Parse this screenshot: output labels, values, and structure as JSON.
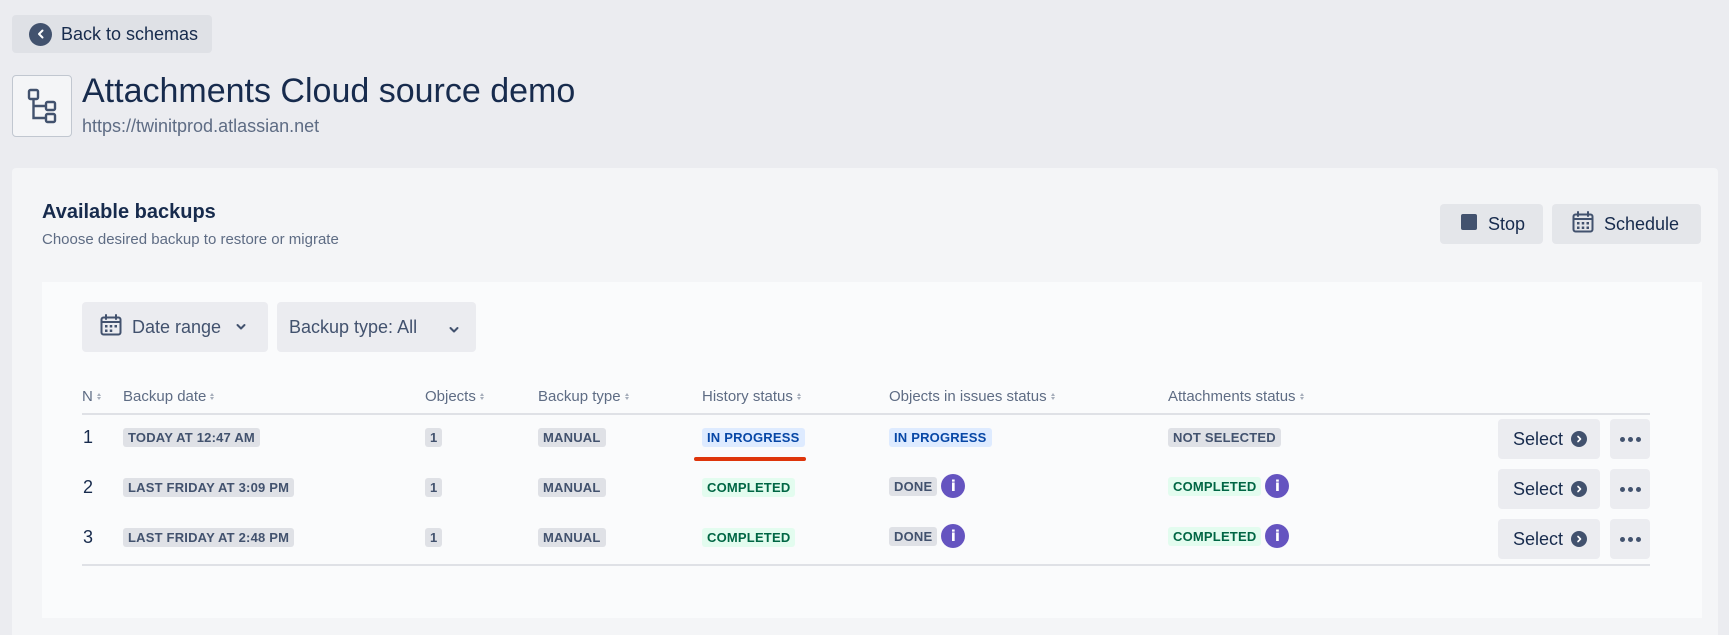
{
  "header": {
    "back_label": "Back to schemas",
    "title": "Attachments Cloud source demo",
    "url": "https://twinitprod.atlassian.net"
  },
  "card": {
    "title": "Available backups",
    "subtitle": "Choose desired backup to restore or migrate",
    "stop_label": "Stop",
    "schedule_label": "Schedule"
  },
  "filters": {
    "date_range_label": "Date range",
    "backup_type_label": "Backup type: All"
  },
  "table": {
    "columns": [
      "N",
      "Backup date",
      "Objects",
      "Backup type",
      "History status",
      "Objects in issues status",
      "Attachments status"
    ],
    "select_label": "Select",
    "rows": [
      {
        "n": "1",
        "date": "TODAY AT 12:47 AM",
        "objects": "1",
        "type": "MANUAL",
        "history": "IN PROGRESS",
        "issues": "IN PROGRESS",
        "attachments": "NOT SELECTED"
      },
      {
        "n": "2",
        "date": "LAST FRIDAY AT 3:09 PM",
        "objects": "1",
        "type": "MANUAL",
        "history": "COMPLETED",
        "issues": "DONE",
        "attachments": "COMPLETED"
      },
      {
        "n": "3",
        "date": "LAST FRIDAY AT 2:48 PM",
        "objects": "1",
        "type": "MANUAL",
        "history": "COMPLETED",
        "issues": "DONE",
        "attachments": "COMPLETED"
      }
    ]
  },
  "colors": {
    "in_progress": "#0747a6",
    "completed": "#006644",
    "info": "#6554c0",
    "annotation": "#de350b"
  }
}
